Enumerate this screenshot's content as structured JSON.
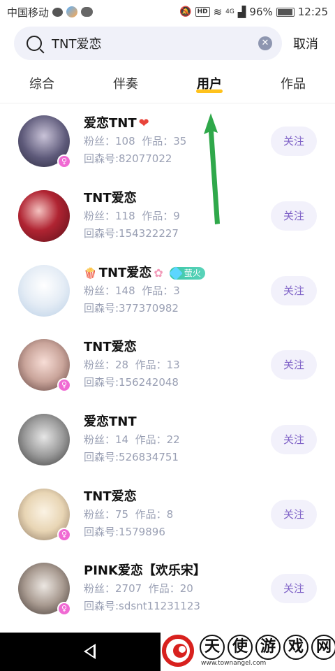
{
  "status_bar": {
    "carrier": "中国移动",
    "network": "4G",
    "battery": "96%",
    "time": "12:25"
  },
  "search": {
    "query": "TNT爱恋",
    "cancel_label": "取消"
  },
  "tabs": [
    {
      "label": "综合",
      "active": false
    },
    {
      "label": "伴奏",
      "active": false
    },
    {
      "label": "用户",
      "active": true
    },
    {
      "label": "作品",
      "active": false
    }
  ],
  "users": [
    {
      "name": "爱恋TNT",
      "fans_label": "粉丝：108",
      "works_label": "作品：35",
      "id_label": "回森号:82077022",
      "follow_label": "关注",
      "badge": "heart",
      "female": true
    },
    {
      "name": "TNT爱恋",
      "fans_label": "粉丝：118",
      "works_label": "作品：9",
      "id_label": "回森号:154322227",
      "follow_label": "关注",
      "badge": "",
      "female": false
    },
    {
      "name": "TNT爱恋",
      "fans_label": "粉丝：148",
      "works_label": "作品：3",
      "id_label": "回森号:377370982",
      "follow_label": "关注",
      "badge": "firefly",
      "badge_text": "萤火",
      "female": false
    },
    {
      "name": "TNT爱恋",
      "fans_label": "粉丝：28",
      "works_label": "作品：13",
      "id_label": "回森号:156242048",
      "follow_label": "关注",
      "badge": "",
      "female": true
    },
    {
      "name": "爱恋TNT",
      "fans_label": "粉丝：14",
      "works_label": "作品：22",
      "id_label": "回森号:526834751",
      "follow_label": "关注",
      "badge": "",
      "female": false
    },
    {
      "name": "TNT爱恋",
      "fans_label": "粉丝：75",
      "works_label": "作品：8",
      "id_label": "回森号:1579896",
      "follow_label": "关注",
      "badge": "",
      "female": true
    },
    {
      "name": "PINK爱恋【欢乐宋】",
      "fans_label": "粉丝：2707",
      "works_label": "作品：20",
      "id_label": "回森号:sdsnt11231123",
      "follow_label": "关注",
      "badge": "",
      "female": true
    }
  ],
  "watermark": {
    "chars": [
      "天",
      "使",
      "游",
      "戏",
      "网"
    ],
    "url": "www.townangel.com"
  }
}
